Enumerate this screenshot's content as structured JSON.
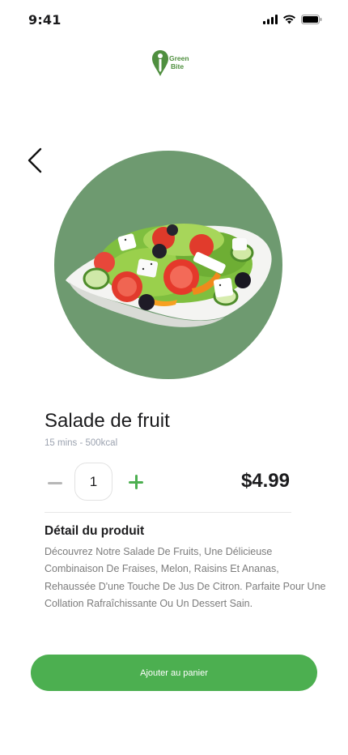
{
  "status_bar": {
    "time": "9:41"
  },
  "brand": {
    "logo_line1": "Green",
    "logo_line2": "Bite",
    "accent_color": "#4caf50"
  },
  "product": {
    "name": "Salade de fruit",
    "meta": "15 mins - 500kcal",
    "quantity": "1",
    "price": "$4.99",
    "image_icon": "salad-image"
  },
  "details": {
    "title": "Détail du produit",
    "description": "Découvrez Notre Salade De Fruits, Une Délicieuse Combinaison De Fraises, Melon, Raisins Et Ananas, Rehaussée D'une Touche De Jus De Citron. Parfaite Pour Une Collation Rafraîchissante Ou Un Dessert Sain."
  },
  "actions": {
    "add_to_cart_label": "Ajouter au panier"
  },
  "icons": {
    "back": "chevron-left-icon",
    "minus": "minus-icon",
    "plus": "plus-icon",
    "signal": "signal-icon",
    "wifi": "wifi-icon",
    "battery": "battery-icon"
  }
}
